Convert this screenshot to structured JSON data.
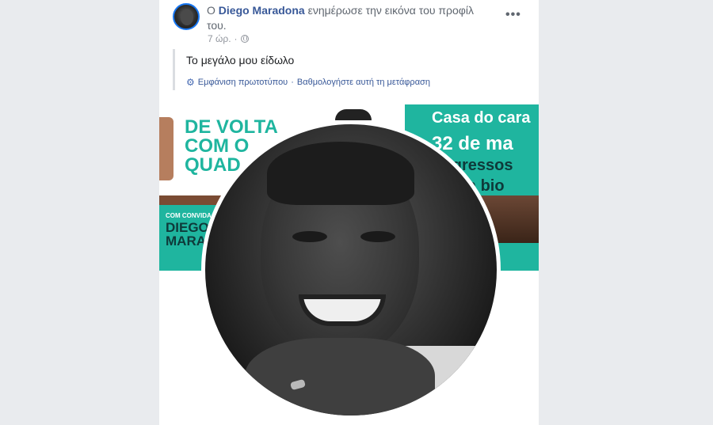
{
  "post": {
    "prefix": "Ο",
    "author": "Diego Maradona",
    "action": "ενημέρωσε την εικόνα του προφίλ του.",
    "time": "7 ώρ.",
    "separator": "·",
    "privacy_icon": "globe-icon",
    "more_label": "•••",
    "translated_text": "Το μεγάλο μου είδωλο",
    "see_original": "Εμφάνιση πρωτοτύπου",
    "link_separator": "·",
    "rate_translation": "Βαθμολογήστε αυτή τη μετάφραση",
    "translation_icon": "gear-icon"
  },
  "cover": {
    "headline": "DE VOLTA\nCOM O\nQUAD",
    "guest_label": "COM CONVIDA",
    "guest_name": "DIEGO\nMARA",
    "casa": "Casa do cara",
    "date": "32 de ma",
    "tickets": "ingressos",
    "link": "k na bio"
  },
  "colors": {
    "link": "#385898",
    "teal": "#1fb59f",
    "page_bg": "#e9ebee"
  }
}
